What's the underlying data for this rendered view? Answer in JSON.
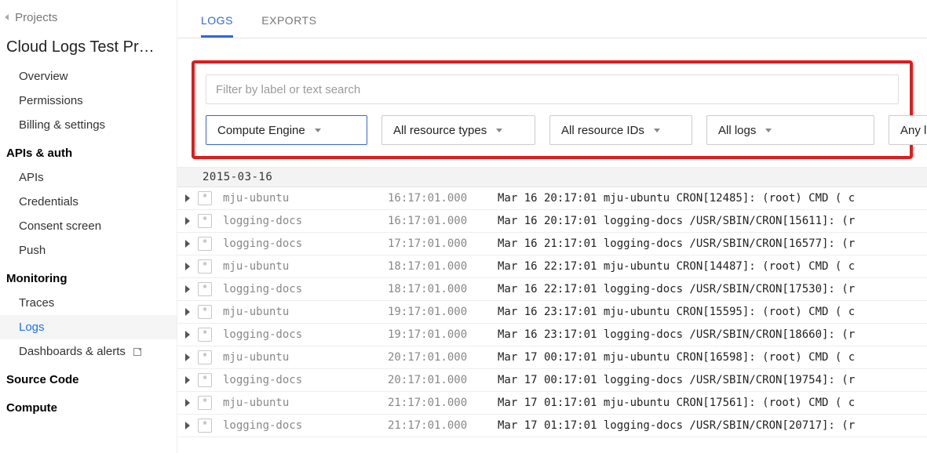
{
  "sidebar": {
    "back_label": "Projects",
    "project_title": "Cloud Logs Test Pr…",
    "group_project": [
      "Overview",
      "Permissions",
      "Billing & settings"
    ],
    "section_apis": {
      "header": "APIs & auth",
      "items": [
        "APIs",
        "Credentials",
        "Consent screen",
        "Push"
      ]
    },
    "section_monitoring": {
      "header": "Monitoring",
      "items": [
        "Traces",
        "Logs",
        "Dashboards & alerts"
      ],
      "active_index": 1,
      "external_index": 2
    },
    "section_source": {
      "header": "Source Code"
    },
    "section_compute": {
      "header": "Compute"
    }
  },
  "tabs": {
    "items": [
      "LOGS",
      "EXPORTS"
    ],
    "active": 0
  },
  "filters": {
    "search_placeholder": "Filter by label or text search",
    "dropdowns": [
      "Compute Engine",
      "All resource types",
      "All resource IDs",
      "All logs",
      "Any log level"
    ]
  },
  "logs": {
    "date_header": "2015-03-16",
    "rows": [
      {
        "source": "mju-ubuntu",
        "local": "16:17:01.000",
        "msg": "Mar 16 20:17:01 mju-ubuntu CRON[12485]: (root) CMD (  c"
      },
      {
        "source": "logging-docs",
        "local": "16:17:01.000",
        "msg": "Mar 16 20:17:01 logging-docs /USR/SBIN/CRON[15611]: (r"
      },
      {
        "source": "logging-docs",
        "local": "17:17:01.000",
        "msg": "Mar 16 21:17:01 logging-docs /USR/SBIN/CRON[16577]: (r"
      },
      {
        "source": "mju-ubuntu",
        "local": "18:17:01.000",
        "msg": "Mar 16 22:17:01 mju-ubuntu CRON[14487]: (root) CMD (  c"
      },
      {
        "source": "logging-docs",
        "local": "18:17:01.000",
        "msg": "Mar 16 22:17:01 logging-docs /USR/SBIN/CRON[17530]: (r"
      },
      {
        "source": "mju-ubuntu",
        "local": "19:17:01.000",
        "msg": "Mar 16 23:17:01 mju-ubuntu CRON[15595]: (root) CMD (  c"
      },
      {
        "source": "logging-docs",
        "local": "19:17:01.000",
        "msg": "Mar 16 23:17:01 logging-docs /USR/SBIN/CRON[18660]: (r"
      },
      {
        "source": "mju-ubuntu",
        "local": "20:17:01.000",
        "msg": "Mar 17 00:17:01 mju-ubuntu CRON[16598]: (root) CMD (  c"
      },
      {
        "source": "logging-docs",
        "local": "20:17:01.000",
        "msg": "Mar 17 00:17:01 logging-docs /USR/SBIN/CRON[19754]: (r"
      },
      {
        "source": "mju-ubuntu",
        "local": "21:17:01.000",
        "msg": "Mar 17 01:17:01 mju-ubuntu CRON[17561]: (root) CMD (  c"
      },
      {
        "source": "logging-docs",
        "local": "21:17:01.000",
        "msg": "Mar 17 01:17:01 logging-docs /USR/SBIN/CRON[20717]: (r"
      }
    ]
  }
}
